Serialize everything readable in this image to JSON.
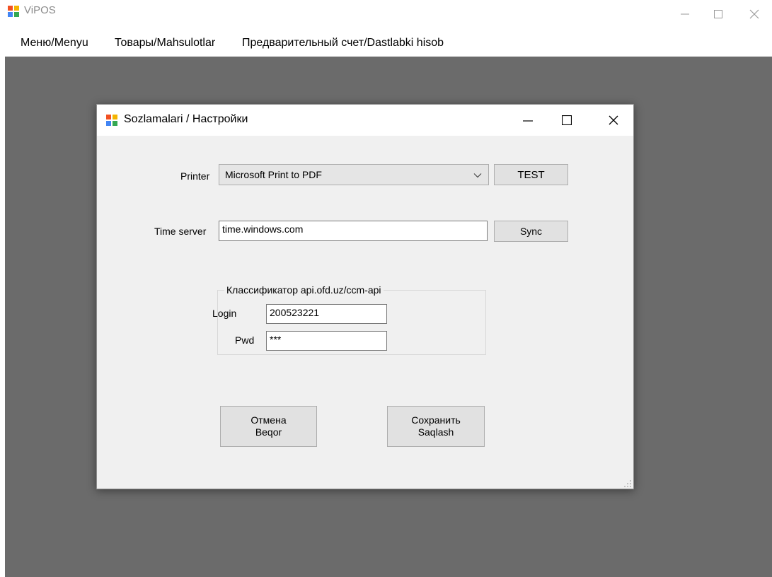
{
  "app": {
    "title": "ViPOS"
  },
  "menu": {
    "items": [
      {
        "label": "Меню/Menyu"
      },
      {
        "label": "Товары/Mahsulotlar"
      },
      {
        "label": "Предварительный счет/Dastlabki hisob"
      }
    ]
  },
  "dialog": {
    "title": "Sozlamalari / Настройки",
    "printer": {
      "label": "Printer",
      "selected": "Microsoft Print to PDF",
      "test_label": "TEST"
    },
    "time_server": {
      "label": "Time server",
      "value": "time.windows.com",
      "sync_label": "Sync"
    },
    "classifier": {
      "title": "Классификатор api.ofd.uz/ccm-api",
      "login_label": "Login",
      "login_value": "200523221",
      "pwd_label": "Pwd",
      "pwd_value": "***"
    },
    "cancel": {
      "line1": "Отмена",
      "line2": "Beqor"
    },
    "save": {
      "line1": "Сохранить",
      "line2": "Saqlash"
    }
  },
  "icons": {
    "app": "app-window-icon",
    "dropdown": "chevron-down-icon"
  },
  "colors": {
    "mdi_background": "#6b6b6b",
    "dialog_background": "#f0f0f0",
    "button_face": "#e1e1e1"
  }
}
